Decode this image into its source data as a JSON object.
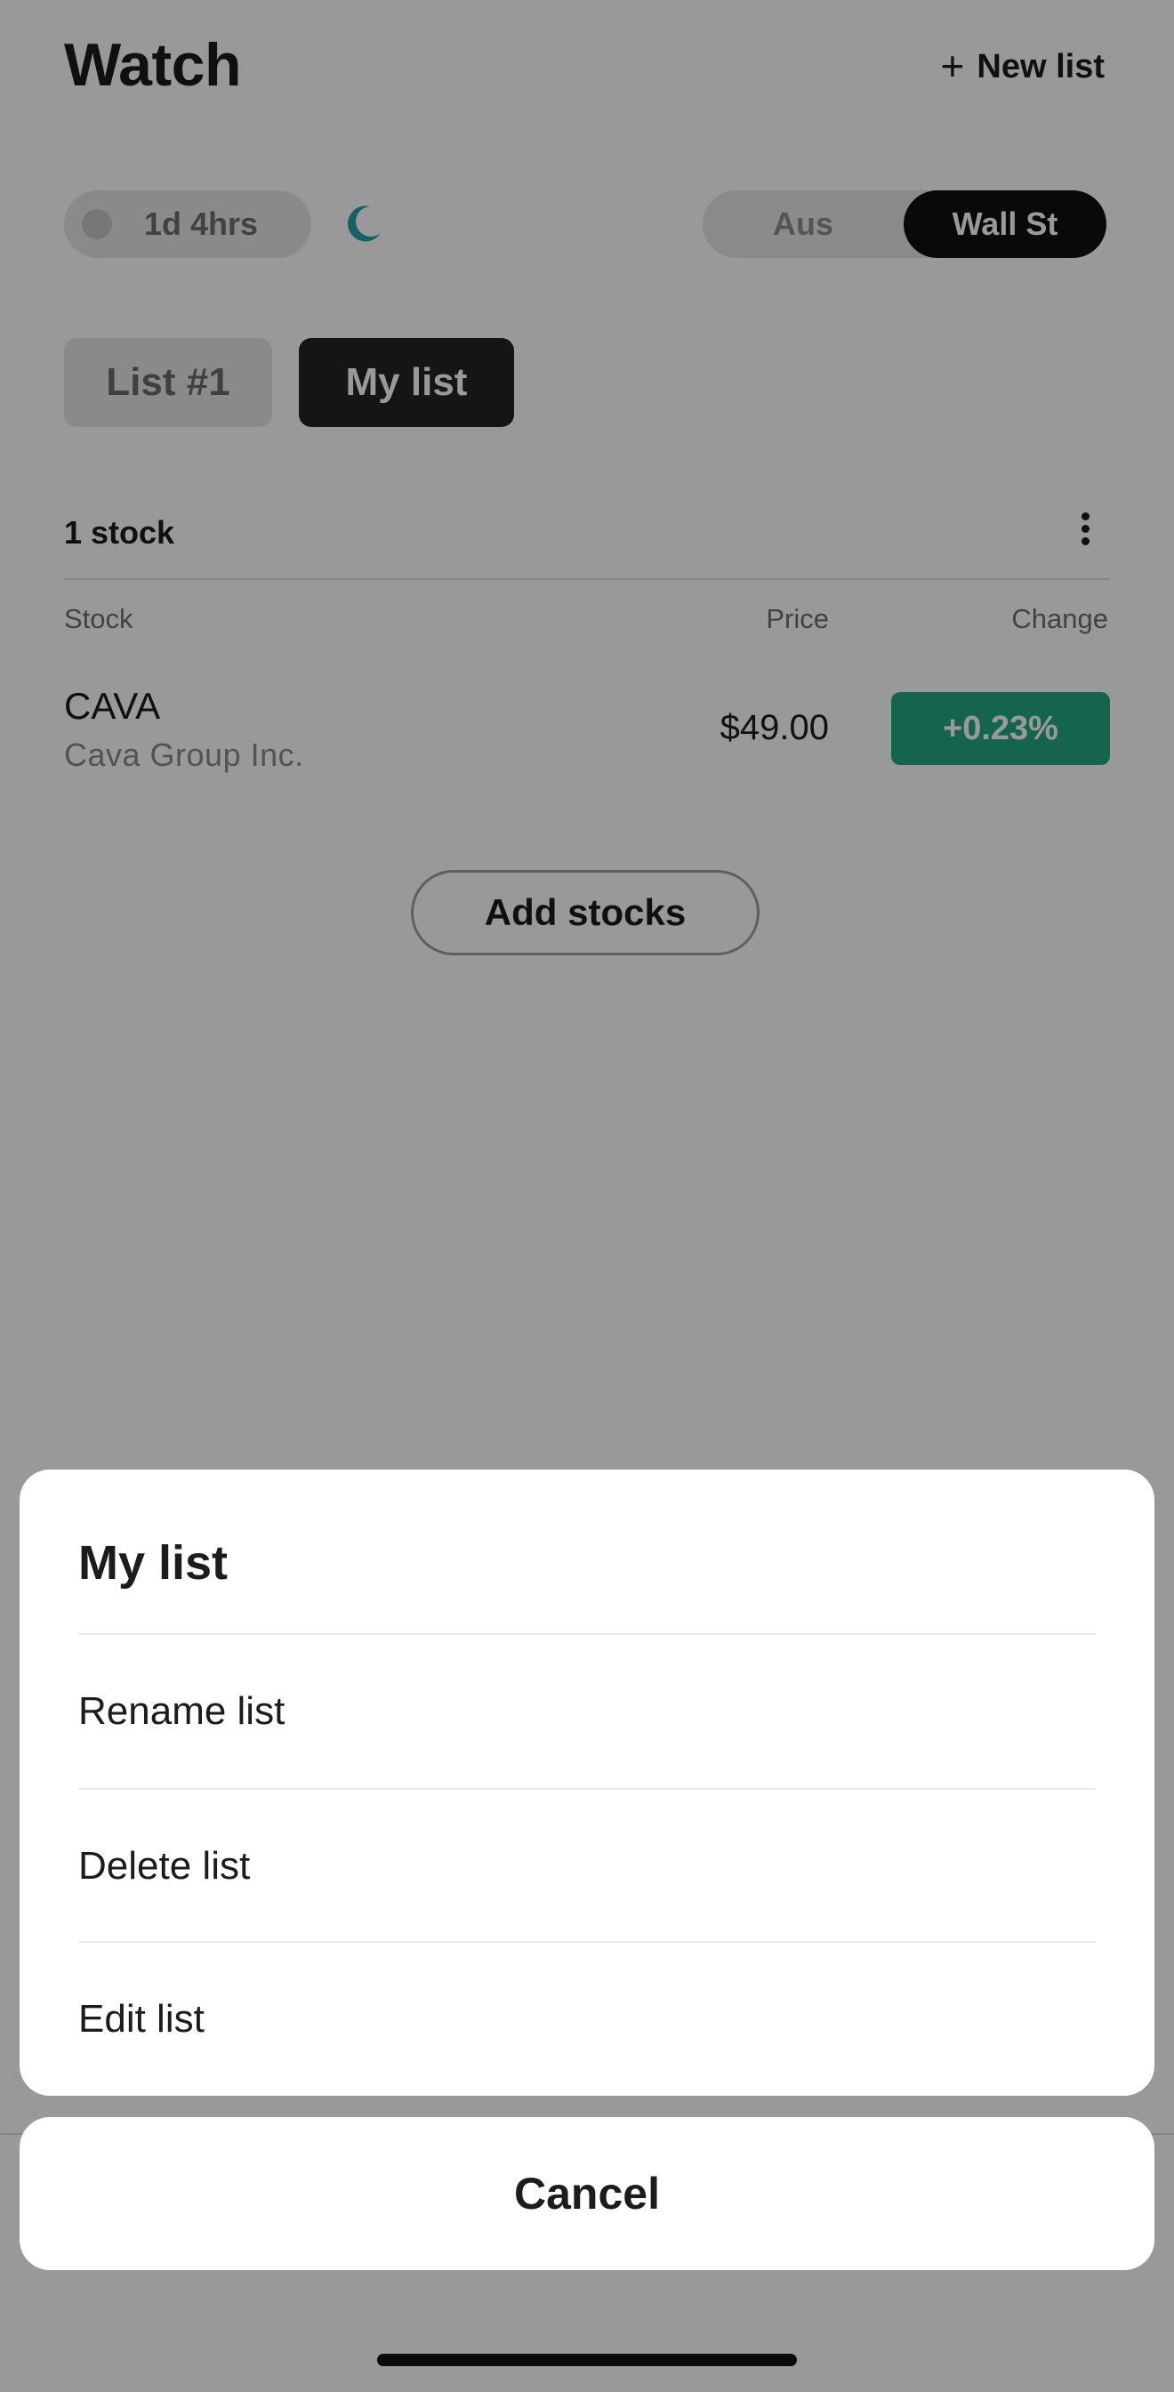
{
  "header": {
    "title": "Watch",
    "new_list_icon": "plus-icon",
    "new_list_label": "New list"
  },
  "market_status": {
    "countdown": "1d 4hrs",
    "session_icon": "moon-icon",
    "moon_color": "#23a2a8"
  },
  "market_toggle": {
    "options": [
      "Aus",
      "Wall St"
    ],
    "selected": "Wall St"
  },
  "list_tabs": [
    {
      "label": "List #1",
      "active": false
    },
    {
      "label": "My list",
      "active": true
    }
  ],
  "stock_list": {
    "count_label": "1 stock",
    "columns": {
      "stock": "Stock",
      "price": "Price",
      "change": "Change"
    },
    "rows": [
      {
        "ticker": "CAVA",
        "name": "Cava Group Inc.",
        "price": "$49.00",
        "change": "+0.23%",
        "change_color": "#23a883"
      }
    ]
  },
  "add_stocks_label": "Add stocks",
  "action_sheet": {
    "title": "My list",
    "items": [
      "Rename list",
      "Delete list",
      "Edit list"
    ],
    "cancel_label": "Cancel"
  }
}
